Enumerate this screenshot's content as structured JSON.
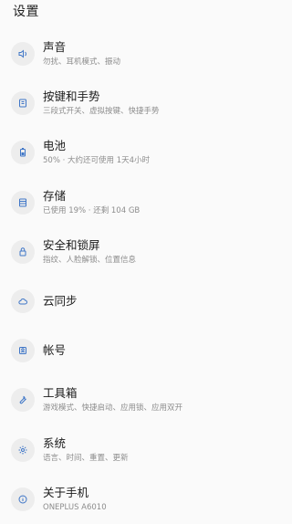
{
  "page": {
    "title": "设置"
  },
  "items": [
    {
      "key": "sound",
      "title": "声音",
      "subtitle": "勿扰、耳机模式、振动",
      "icon": "speaker-icon"
    },
    {
      "key": "buttons-gestures",
      "title": "按键和手势",
      "subtitle": "三段式开关、虚拟按键、快捷手势",
      "icon": "button-icon"
    },
    {
      "key": "battery",
      "title": "电池",
      "subtitle": "50% · 大约还可使用 1天4小时",
      "icon": "battery-icon"
    },
    {
      "key": "storage",
      "title": "存储",
      "subtitle": "已使用 19% · 还剩 104 GB",
      "icon": "storage-icon"
    },
    {
      "key": "security",
      "title": "安全和锁屏",
      "subtitle": "指纹、人脸解锁、位置信息",
      "icon": "lock-icon"
    },
    {
      "key": "cloud-sync",
      "title": "云同步",
      "subtitle": "",
      "icon": "cloud-icon"
    },
    {
      "key": "account",
      "title": "帐号",
      "subtitle": "",
      "icon": "account-icon"
    },
    {
      "key": "toolbox",
      "title": "工具箱",
      "subtitle": "游戏模式、快捷启动、应用锁、应用双开",
      "icon": "tools-icon"
    },
    {
      "key": "system",
      "title": "系统",
      "subtitle": "语言、时间、重置、更新",
      "icon": "gear-icon"
    },
    {
      "key": "about",
      "title": "关于手机",
      "subtitle": "ONEPLUS A6010",
      "icon": "info-icon"
    }
  ],
  "colors": {
    "background": "#fafafa",
    "icon_circle": "#ededed",
    "icon_accent": "#3f76c7",
    "title_text": "#1b1b1b",
    "subtitle_text": "#8c8c8c"
  }
}
